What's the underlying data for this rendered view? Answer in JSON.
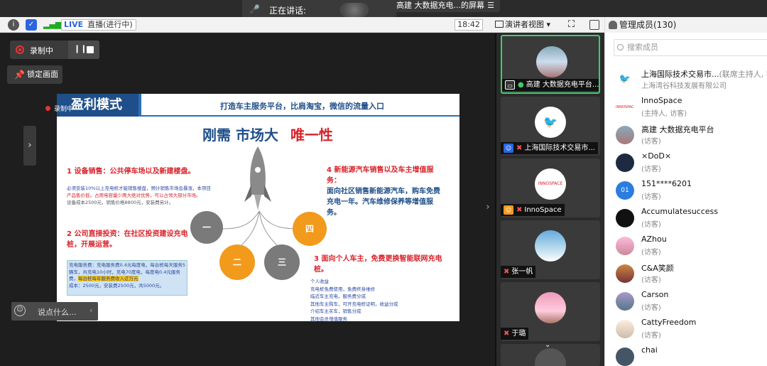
{
  "top": {
    "speaking_label": "正在讲话:",
    "screen_tab": "高建 大数据充电...的屏幕",
    "live_badge": "LIVE",
    "live_status": "直播(进行中)",
    "time": "18:42",
    "view_mode": "演讲者视图"
  },
  "stage": {
    "recording_label": "录制中",
    "lock_screen": "锁定画面",
    "chat_placeholder": "说点什么..."
  },
  "slide": {
    "title": "盈利模式",
    "subtitle": "打造车主服务平台，比肩淘宝，微信的流量入口",
    "headline_a": "刚需  市场大",
    "headline_b": "唯一性",
    "sec1_title": "1 设备销售：公共停车场以及新建楼盘。",
    "sec1_body_a": "必须安装10%以上充电桩才能销售楼盘，预计销售市场会暴涨，本项目",
    "sec1_body_b": "产品售价低，占用电容量少两大绝对优势，可以占领大部分市场。",
    "sec1_body_c": "设备成本2500元，销售价格8800元，安装费另计。",
    "sec2_title": "2 公司直接投资：在社区投资建设充电桩，开展运营。",
    "sec2_box": "充电服务费：充电服务费0.4元每度电，每台桩每天服务5辆车，共充电10小时，充电70度电，每度电0.4元服务费，",
    "sec2_box_hl": "每台桩每年服务费收入近万元",
    "sec2_box_b": "成本：2500元，安装费2500元，共5000元。",
    "sec4_title": "4 新能源汽车销售以及车主增值服务：",
    "sec4_body": "面向社区销售新能源汽车，购车免费充电一年。汽车维修保养等增值服务。",
    "sec3_title": "3 面向个人车主，免费更换智能联网充电桩。",
    "sec3_lines": [
      "个人收益",
      "充电桩免费使用，免费终身维修",
      "临近车主充电，服务费分成",
      "其他车主购车，可开充电桩证明，收益分成",
      "介绍车主买车，销售分成",
      "其他会员增值服务"
    ],
    "circles": [
      "一",
      "二",
      "三",
      "四"
    ],
    "rec_mini": "录制中"
  },
  "tiles": [
    {
      "name": "高建 大数据充电平台...",
      "icon": "screen-share-icon"
    },
    {
      "name": "上海国际技术交易市...",
      "icon": "user-icon"
    },
    {
      "name": "InnoSpace",
      "icon": "user-icon"
    },
    {
      "name": "张一帆",
      "icon": "mic-muted-icon"
    },
    {
      "name": "于璐",
      "icon": "mic-muted-icon"
    }
  ],
  "members": {
    "header": "管理成员(130)",
    "search_placeholder": "搜索成员",
    "list": [
      {
        "name": "上海国际技术交易市...",
        "extra": "(联席主持人, 我",
        "role": "上海湾谷科技发展有限公司"
      },
      {
        "name": "InnoSpace",
        "extra": "",
        "role": "(主持人, 访客)"
      },
      {
        "name": "高建 大数据充电平台",
        "extra": "",
        "role": "(访客)"
      },
      {
        "name": "×DoD×",
        "extra": "",
        "role": "(访客)"
      },
      {
        "name": "151****6201",
        "extra": "",
        "role": "(访客)"
      },
      {
        "name": "Accumulatesuccess",
        "extra": "",
        "role": "(访客)"
      },
      {
        "name": "AZhou",
        "extra": "",
        "role": "(访客)"
      },
      {
        "name": "C&A笑颜",
        "extra": "",
        "role": "(访客)"
      },
      {
        "name": "Carson",
        "extra": "",
        "role": "(访客)"
      },
      {
        "name": "CattyFreedom",
        "extra": "",
        "role": "(访客)"
      },
      {
        "name": "chai",
        "extra": "",
        "role": ""
      }
    ],
    "avatar_texts": [
      "",
      "INNOSPACE",
      "",
      "",
      "01",
      "",
      "",
      "",
      "",
      "",
      ""
    ]
  }
}
